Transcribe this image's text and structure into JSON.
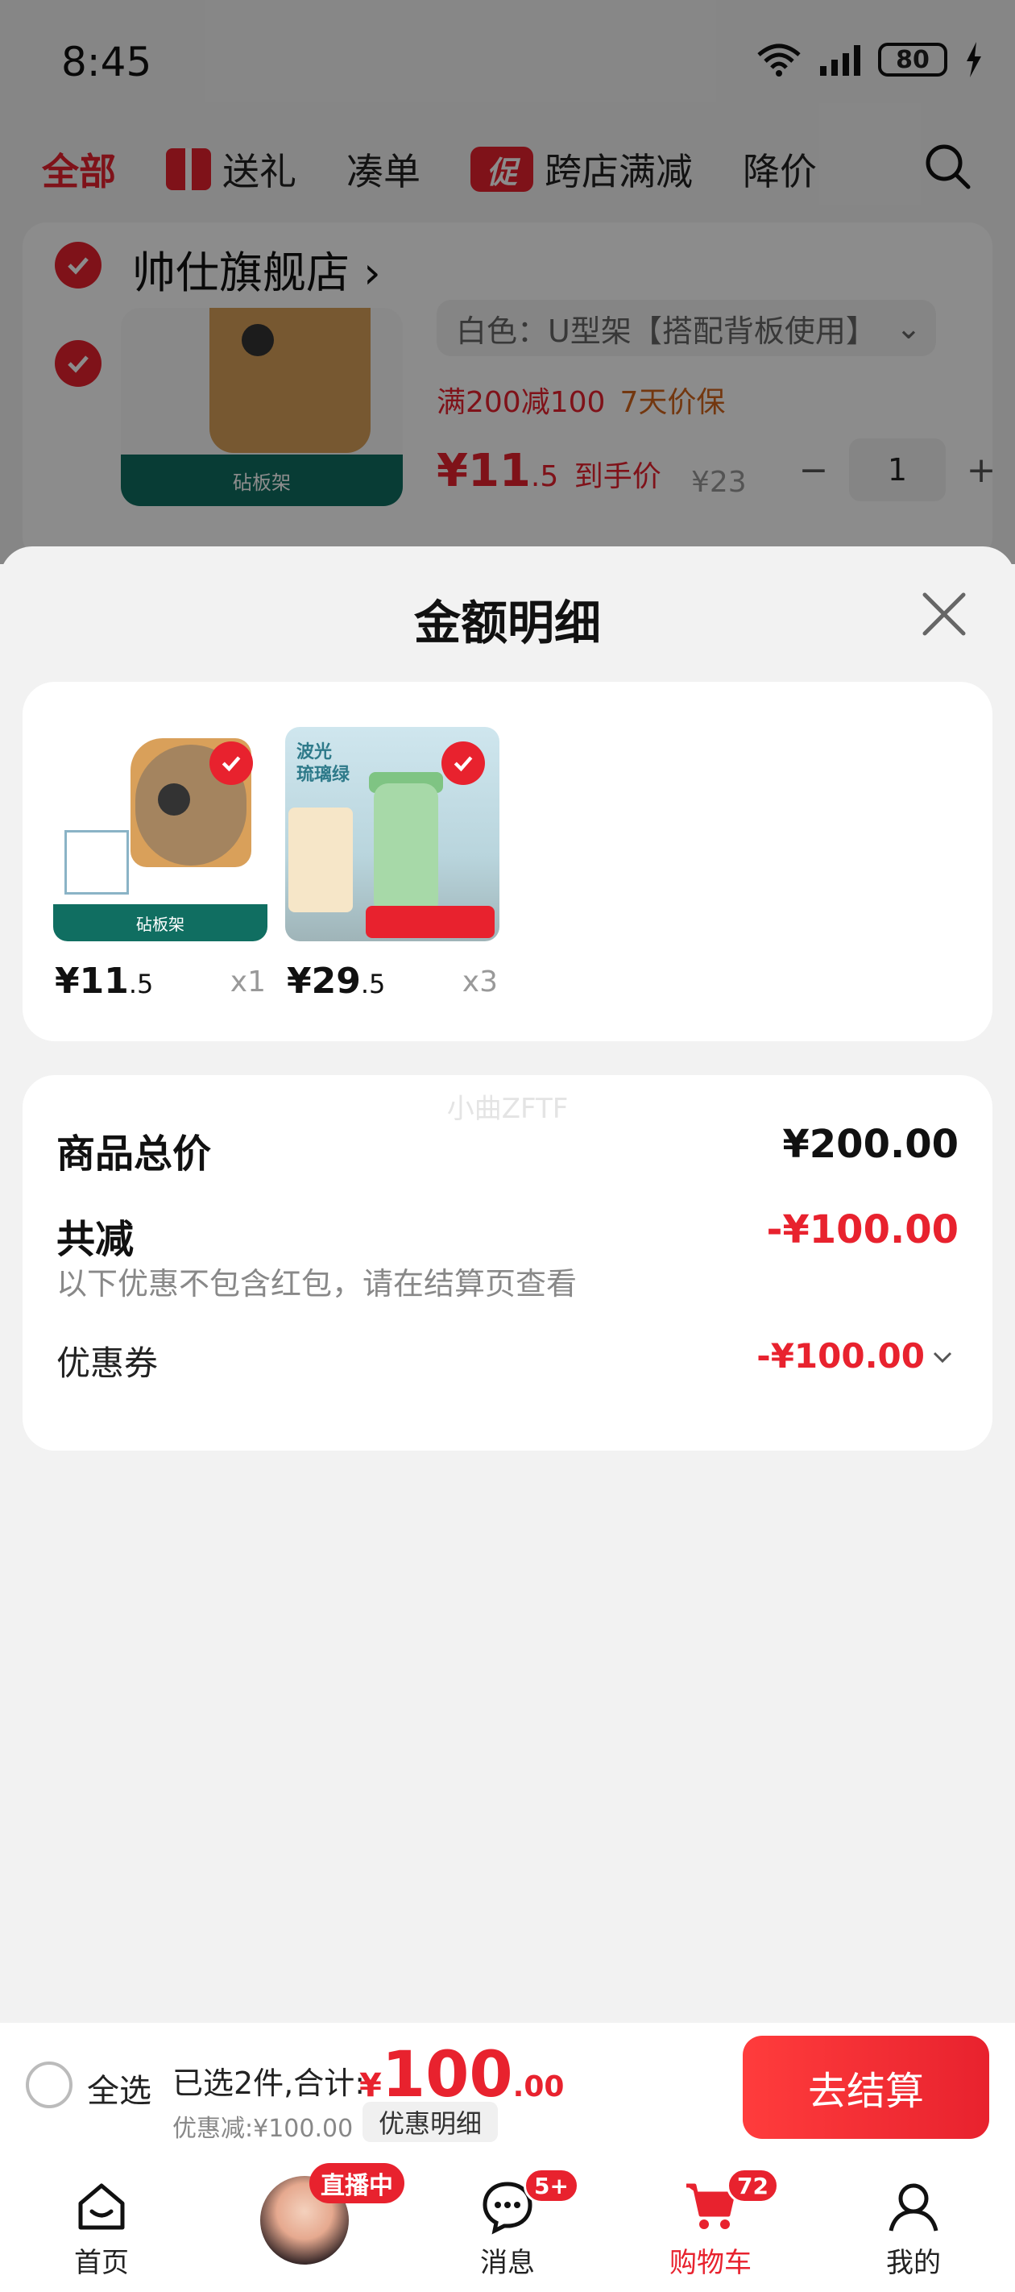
{
  "status_bar": {
    "time": "8:45",
    "battery": "80"
  },
  "category_tabs": [
    {
      "label": "全部",
      "active": true
    },
    {
      "label": "送礼",
      "icon": "gift-icon"
    },
    {
      "label": "凑单"
    },
    {
      "label": "跨店满减",
      "icon": "promo-icon",
      "icon_text": "促"
    },
    {
      "label": "降价"
    }
  ],
  "store": {
    "name": "帅仕旗舰店",
    "item": {
      "thumb_label": "砧板架",
      "variant": "白色：U型架【搭配背板使用】",
      "promo": "满200减100",
      "guarantee": "7天价保",
      "price_int": "¥11",
      "price_dec": ".5",
      "price_suffix": "到手价",
      "orig_price": "¥23",
      "qty": "1"
    }
  },
  "sheet": {
    "title": "金额明细",
    "products": [
      {
        "price_int": "¥11",
        "price_dec": ".5",
        "qty": "x1",
        "thumb_label": "砧板架"
      },
      {
        "price_int": "¥29",
        "price_dec": ".5",
        "qty": "x3",
        "thumb_label": "波光\n琉璃绿"
      }
    ],
    "watermark": "小曲ZFTF",
    "total_label": "商品总价",
    "total_value": "¥200.00",
    "reduce_label": "共减",
    "reduce_value": "-¥100.00",
    "reduce_note": "以下优惠不包含红包，请在结算页查看",
    "coupon_label": "优惠券",
    "coupon_value": "-¥100.00"
  },
  "checkout": {
    "select_all": "全选",
    "selected": "已选2件,合计:",
    "currency": "¥",
    "sum_int": "100",
    "sum_dec": ".00",
    "discount": "优惠减:¥100.00",
    "detail_button": "优惠明细",
    "checkout_button": "去结算"
  },
  "bottom_nav": [
    {
      "label": "首页",
      "icon": "home-icon"
    },
    {
      "label": "",
      "icon": "live-avatar",
      "badge": "直播中"
    },
    {
      "label": "消息",
      "icon": "message-icon",
      "badge": "5+"
    },
    {
      "label": "购物车",
      "icon": "cart-icon",
      "badge": "72",
      "active": true
    },
    {
      "label": "我的",
      "icon": "profile-icon"
    }
  ],
  "colors": {
    "accent": "#e8222e",
    "promo_orange": "#d2651d",
    "green_band": "#106e61"
  }
}
